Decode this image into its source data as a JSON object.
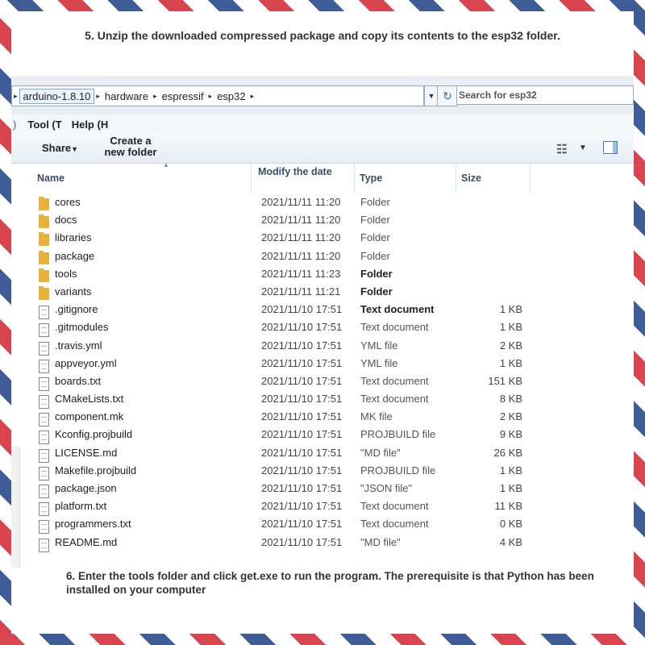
{
  "instructions": {
    "step5": "5. Unzip the downloaded compressed package and copy its contents to the esp32 folder.",
    "step6": "6. Enter the tools folder and click get.exe to run the program. The prerequisite is that Python has been installed on your computer"
  },
  "address_bar": {
    "crumbs": [
      "arduino-1.8.10",
      "hardware",
      "espressif",
      "esp32"
    ],
    "search_placeholder": "Search for esp32"
  },
  "menu": {
    "items": [
      "Tool (T",
      "Help (H"
    ]
  },
  "toolbar": {
    "share_label": "Share",
    "new_folder_label": "Create a new folder"
  },
  "columns": {
    "name": "Name",
    "date": "Modify the date",
    "type": "Type",
    "size": "Size"
  },
  "files": [
    {
      "name": "cores",
      "date": "2021/11/11 11:20",
      "type": "Folder",
      "size": "",
      "icon": "folder-icon",
      "bold": false
    },
    {
      "name": "docs",
      "date": "2021/11/11 11:20",
      "type": "Folder",
      "size": "",
      "icon": "folder-icon",
      "bold": false
    },
    {
      "name": "libraries",
      "date": "2021/11/11 11:20",
      "type": "Folder",
      "size": "",
      "icon": "folder-icon",
      "bold": false
    },
    {
      "name": "package",
      "date": "2021/11/11 11:20",
      "type": "Folder",
      "size": "",
      "icon": "folder-icon",
      "bold": false
    },
    {
      "name": "tools",
      "date": "2021/11/11 11:23",
      "type": "Folder",
      "size": "",
      "icon": "folder-icon",
      "bold": true
    },
    {
      "name": "variants",
      "date": "2021/11/11 11:21",
      "type": "Folder",
      "size": "",
      "icon": "folder-icon",
      "bold": true
    },
    {
      "name": ".gitignore",
      "date": "2021/11/10 17:51",
      "type": "Text document",
      "size": "1 KB",
      "icon": "document-icon",
      "bold": true
    },
    {
      "name": ".gitmodules",
      "date": "2021/11/10 17:51",
      "type": "Text document",
      "size": "1 KB",
      "icon": "document-icon",
      "bold": false
    },
    {
      "name": ".travis.yml",
      "date": "2021/11/10 17:51",
      "type": "YML file",
      "size": "2 KB",
      "icon": "document-icon",
      "bold": false
    },
    {
      "name": "appveyor.yml",
      "date": "2021/11/10 17:51",
      "type": "YML file",
      "size": "1 KB",
      "icon": "document-icon",
      "bold": false
    },
    {
      "name": "boards.txt",
      "date": "2021/11/10 17:51",
      "type": "Text document",
      "size": "151 KB",
      "icon": "document-icon",
      "bold": false
    },
    {
      "name": "CMakeLists.txt",
      "date": "2021/11/10 17:51",
      "type": "Text document",
      "size": "8 KB",
      "icon": "document-icon",
      "bold": false
    },
    {
      "name": "component.mk",
      "date": "2021/11/10 17:51",
      "type": "MK file",
      "size": "2 KB",
      "icon": "document-icon",
      "bold": false
    },
    {
      "name": "Kconfig.projbuild",
      "date": "2021/11/10 17:51",
      "type": "PROJBUILD file",
      "size": "9 KB",
      "icon": "document-icon",
      "bold": false
    },
    {
      "name": "LICENSE.md",
      "date": "2021/11/10 17:51",
      "type": "\"MD file\"",
      "size": "26 KB",
      "icon": "document-icon",
      "bold": false
    },
    {
      "name": "Makefile.projbuild",
      "date": "2021/11/10 17:51",
      "type": "PROJBUILD file",
      "size": "1 KB",
      "icon": "document-icon",
      "bold": false
    },
    {
      "name": "package.json",
      "date": "2021/11/10 17:51",
      "type": "\"JSON file\"",
      "size": "1 KB",
      "icon": "document-icon",
      "bold": false
    },
    {
      "name": "platform.txt",
      "date": "2021/11/10 17:51",
      "type": "Text document",
      "size": "11 KB",
      "icon": "document-icon",
      "bold": false
    },
    {
      "name": "programmers.txt",
      "date": "2021/11/10 17:51",
      "type": "Text document",
      "size": "0 KB",
      "icon": "document-icon",
      "bold": false
    },
    {
      "name": "README.md",
      "date": "2021/11/10 17:51",
      "type": "\"MD file\"",
      "size": "4 KB",
      "icon": "document-icon",
      "bold": false
    }
  ],
  "colors": {
    "border_red": "#d9454f",
    "border_blue": "#3e5d96",
    "folder": "#e7b23a",
    "header_text": "#3a4c66"
  }
}
